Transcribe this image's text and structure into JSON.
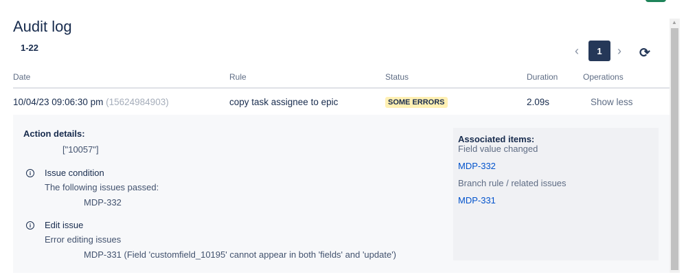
{
  "header": {
    "title": "Audit log",
    "range": "1-22"
  },
  "pagination": {
    "prev": "‹",
    "current": "1",
    "next": "›",
    "refresh_icon": "⟳"
  },
  "table": {
    "columns": [
      "Date",
      "Rule",
      "Status",
      "Duration",
      "Operations"
    ],
    "rows": [
      {
        "date": "10/04/23 09:06:30 pm",
        "id": "(15624984903)",
        "rule": "copy task assignee to epic",
        "status": "SOME ERRORS",
        "duration": "2.09s",
        "operation": "Show less"
      }
    ]
  },
  "details": {
    "action_label": "Action details:",
    "action_value": "[\"10057\"]",
    "steps": [
      {
        "title": "Issue condition",
        "desc": "The following issues passed:",
        "value": "MDP-332"
      },
      {
        "title": "Edit issue",
        "desc": "Error editing issues",
        "value": "MDP-331 (Field 'customfield_10195' cannot appear in both 'fields' and 'update')"
      }
    ],
    "associated": {
      "label": "Associated items:",
      "groups": [
        {
          "title": "Field value changed",
          "link": "MDP-332"
        },
        {
          "title": "Branch rule / related issues",
          "link": "MDP-331"
        }
      ]
    }
  },
  "colors": {
    "accent": "#253858",
    "badge": "#fff0b3",
    "link": "#0052cc"
  }
}
